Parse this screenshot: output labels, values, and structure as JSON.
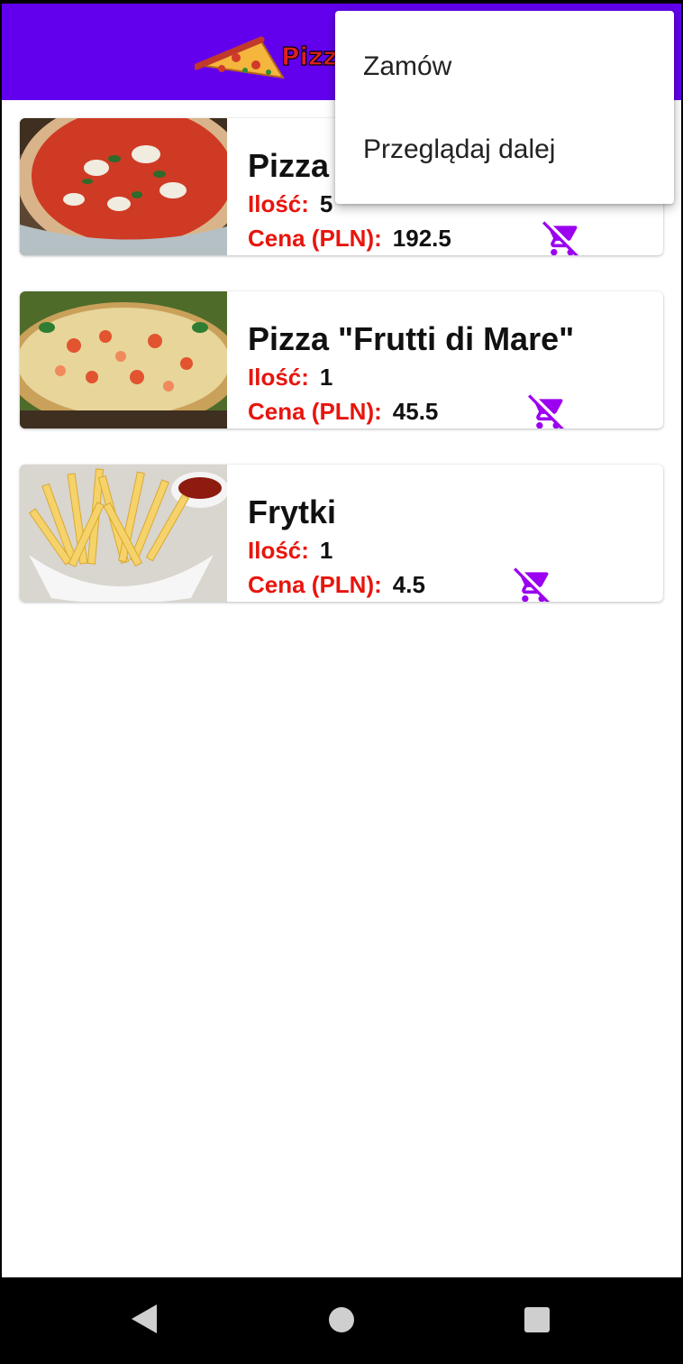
{
  "appbar": {
    "logo_text": "Pizza",
    "background": "#6200ee"
  },
  "menu": {
    "items": [
      {
        "label": "Zamów"
      },
      {
        "label": "Przeglądaj dalej"
      }
    ]
  },
  "cart": {
    "qty_label": "Ilość:",
    "price_label": "Cena (PLN):",
    "remove_icon": "remove-shopping-cart-icon",
    "items": [
      {
        "name": "Pizza \"Margherita\"",
        "qty": "5",
        "price": "192.5",
        "image": "pizza-margherita-image"
      },
      {
        "name": "Pizza \"Frutti di Mare\"",
        "qty": "1",
        "price": "45.5",
        "image": "pizza-frutti-di-mare-image"
      },
      {
        "name": "Frytki",
        "qty": "1",
        "price": "4.5",
        "image": "fries-image"
      }
    ]
  },
  "colors": {
    "accent": "#6200ee",
    "label_red": "#e8150d",
    "cart_icon": "#9b00f0"
  },
  "navbar": {
    "buttons": [
      "back-icon",
      "home-icon",
      "recents-icon"
    ]
  }
}
